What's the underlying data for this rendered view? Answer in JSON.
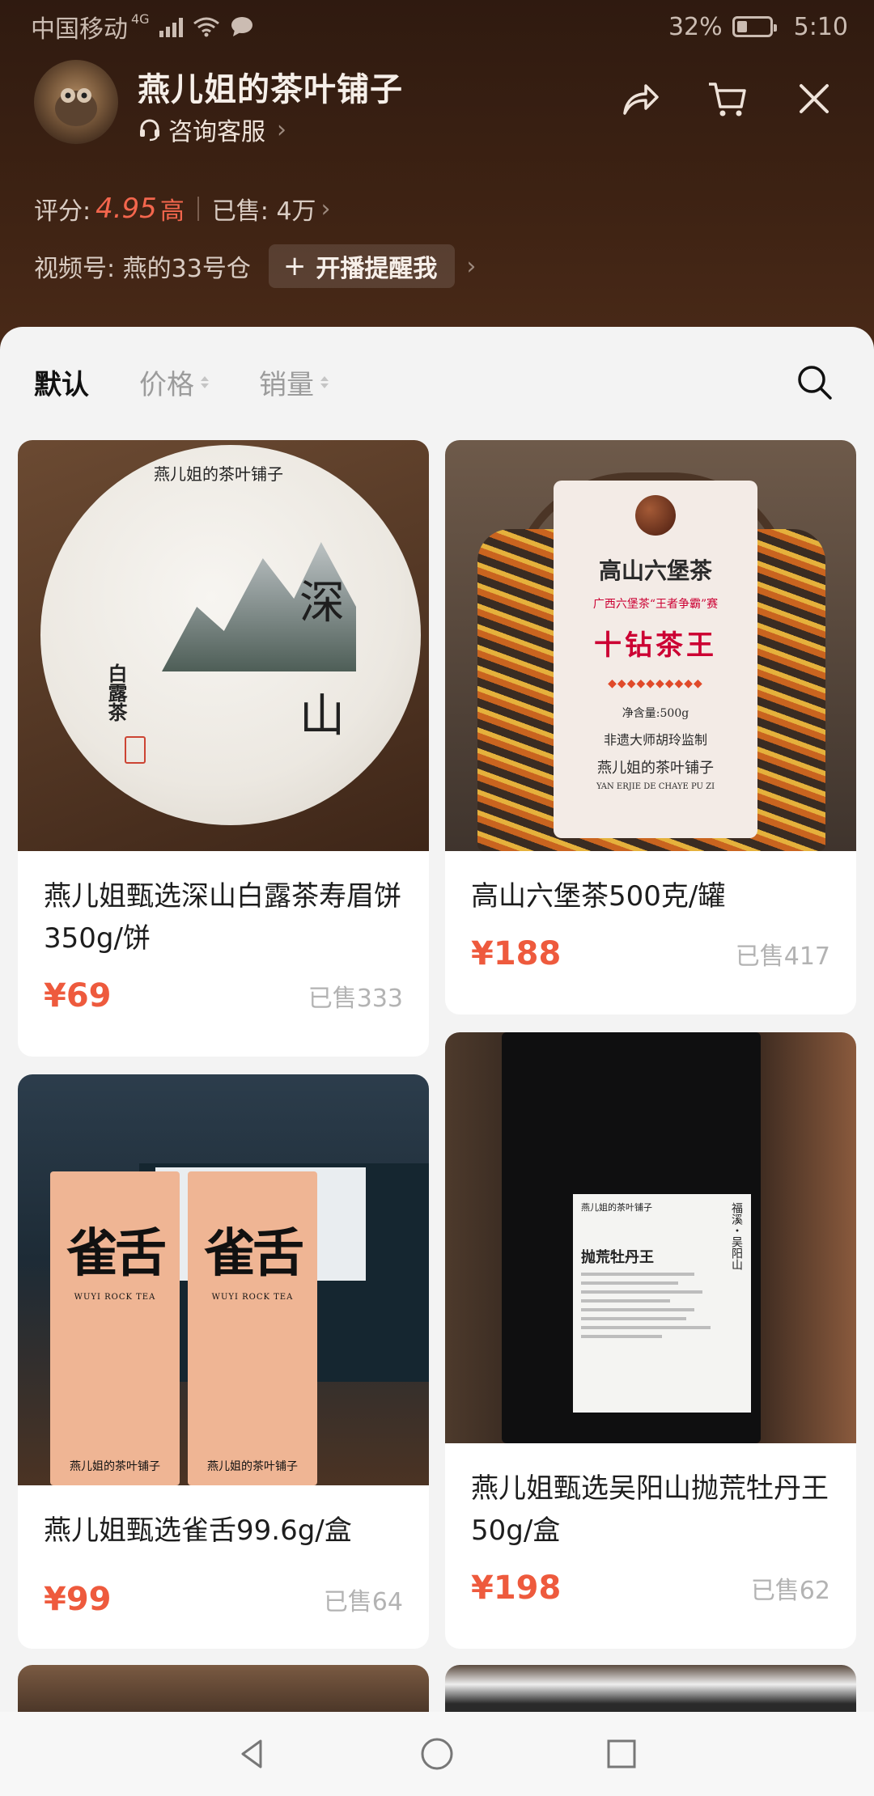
{
  "status_bar": {
    "carrier": "中国移动",
    "network": "4G",
    "battery": "32%",
    "battery_level": 0.32,
    "time": "5:10"
  },
  "header": {
    "shop_name": "燕儿姐的茶叶铺子",
    "service_label": "咨询客服",
    "rating_label": "评分:",
    "rating_value": "4.95",
    "rating_badge": "高",
    "sold_label": "已售: 4万",
    "channel_label": "视频号: 燕的33号仓",
    "remind_label": "开播提醒我",
    "icons": [
      "share-icon",
      "cart-icon",
      "close-icon"
    ]
  },
  "sort_bar": {
    "tabs": [
      "默认",
      "价格",
      "销量"
    ],
    "active_tab": "默认"
  },
  "products": [
    {
      "title": "燕儿姐甄选深山白露茶寿眉饼350g/饼",
      "price": "¥69",
      "sold": "已售333"
    },
    {
      "title": "高山六堡茶500克/罐",
      "price": "¥188",
      "sold": "已售417"
    },
    {
      "title": "燕儿姐甄选雀舌99.6g/盒",
      "price": "¥99",
      "sold": "已售64"
    },
    {
      "title": "燕儿姐甄选吴阳山抛荒牡丹王50g/盒",
      "price": "¥198",
      "sold": "已售62"
    }
  ],
  "product_art": {
    "cake_shop": "燕儿姐的茶叶铺子",
    "cake_big_1": "深",
    "cake_big_2": "山",
    "cake_side": "白露茶",
    "tag_title": "高山六堡茶",
    "tag_sub": "广西六堡茶“王者争霸”赛",
    "tag_main": "十钻茶王",
    "tag_weight": "净含量:500g",
    "tag_master": "非遗大师胡玲监制",
    "tag_shop": "燕儿姐的茶叶铺子",
    "tag_pinyin": "YAN ERJIE DE CHAYE PU ZI",
    "pack_big": "雀舌",
    "pack_en": "WUYI ROCK TEA",
    "pack_shop": "燕儿姐的茶叶铺子",
    "tin_title": "抛荒牡丹王",
    "tin_shop": "燕儿姐的茶叶铺子",
    "tin_mountain": "福溪・吴阳山"
  },
  "nav": {
    "icons": [
      "back-icon",
      "home-icon",
      "recents-icon"
    ]
  },
  "colors": {
    "header_bg": "#3d2213",
    "accent_price": "#ee5a3d",
    "rating": "#f3664d",
    "panel_bg": "#f3f3f3"
  }
}
